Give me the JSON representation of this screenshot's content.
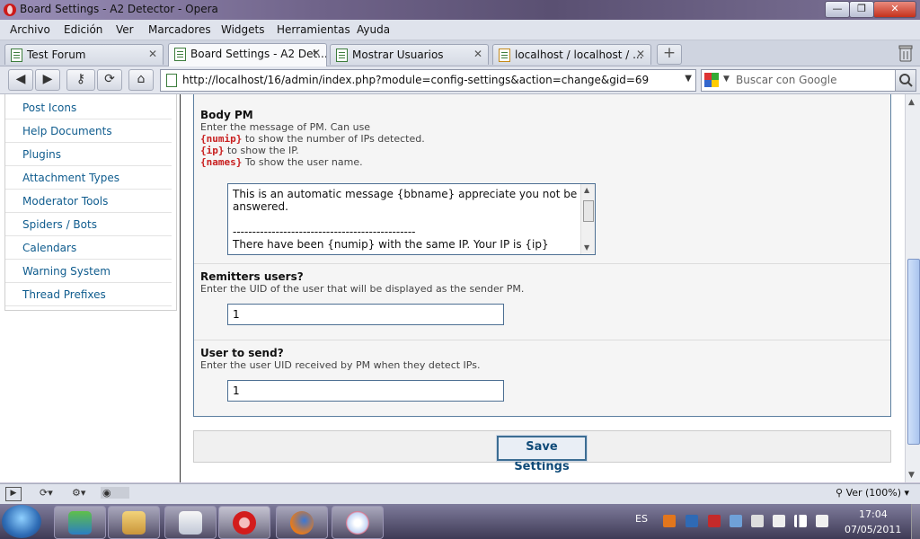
{
  "window": {
    "title": "Board Settings - A2 Detector - Opera"
  },
  "menu": [
    "Archivo",
    "Edición",
    "Ver",
    "Marcadores",
    "Widgets",
    "Herramientas",
    "Ayuda"
  ],
  "tabs": [
    {
      "label": "Test Forum"
    },
    {
      "label": "Board Settings - A2 Det..."
    },
    {
      "label": "Mostrar Usuarios"
    },
    {
      "label": "localhost / localhost / ..."
    }
  ],
  "address": {
    "url": "http://localhost/16/admin/index.php?module=config-settings&action=change&gid=69"
  },
  "search": {
    "placeholder": "Buscar con Google"
  },
  "sidebar": {
    "items": [
      {
        "label": "Post Icons"
      },
      {
        "label": "Help Documents"
      },
      {
        "label": "Plugins"
      },
      {
        "label": "Attachment Types"
      },
      {
        "label": "Moderator Tools"
      },
      {
        "label": "Spiders / Bots"
      },
      {
        "label": "Calendars"
      },
      {
        "label": "Warning System"
      },
      {
        "label": "Thread Prefixes"
      }
    ]
  },
  "settings": {
    "body_pm": {
      "title": "Body PM",
      "desc": "Enter the message of PM. Can use",
      "vars": [
        {
          "code": "{numip}",
          "text": " to show the number of IPs detected."
        },
        {
          "code": "{ip}",
          "text": " to show the IP."
        },
        {
          "code": "{names}",
          "text": " To show the user name."
        }
      ],
      "value": "This is an automatic message {bbname} appreciate you not be answered.\n\n-----------------------------------------------\nThere have been {numip} with the same IP. Your IP is {ip}"
    },
    "remitters": {
      "title": "Remitters users?",
      "desc": "Enter the UID of the user that will be displayed as the sender PM.",
      "value": "1"
    },
    "user_to_send": {
      "title": "User to send?",
      "desc": "Enter the user UID received by PM when they detect IPs.",
      "value": "1"
    },
    "save_label": "Save Settings"
  },
  "status": {
    "zoom": "Ver (100%)"
  },
  "taskbar": {
    "lang": "ES",
    "time": "17:04",
    "date": "07/05/2011"
  }
}
